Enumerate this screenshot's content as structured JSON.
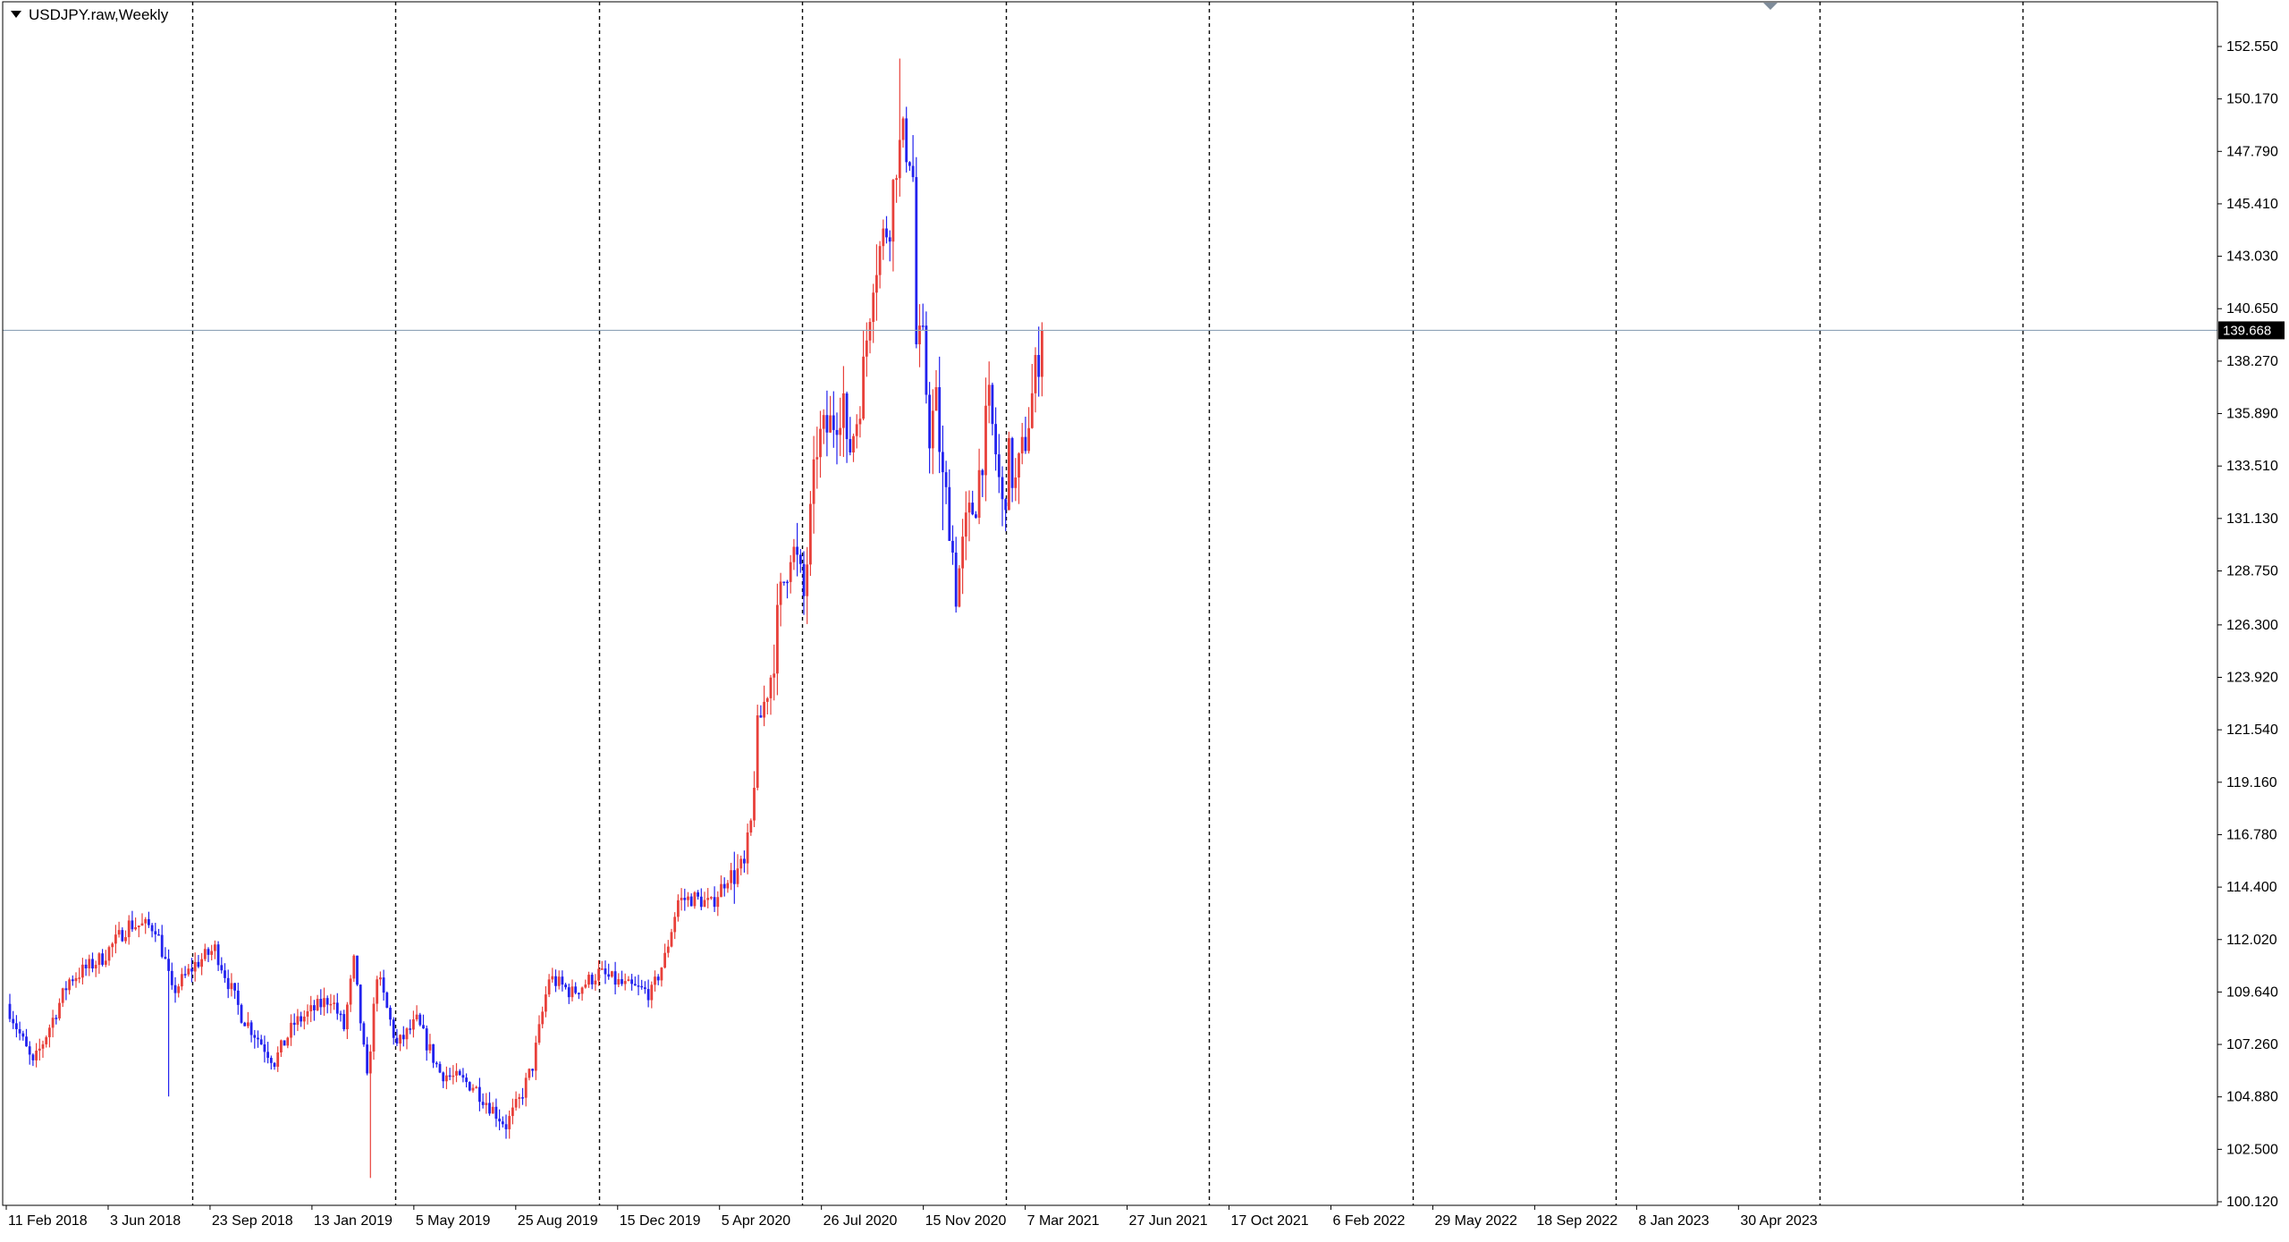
{
  "symbol_title": "USDJPY.raw,Weekly",
  "current_price_label": "139.668",
  "colors": {
    "bull": "#e8403a",
    "bear": "#2222ee",
    "grid": "#000000",
    "price_line": "#8fa3b8",
    "price_tag_bg": "#000000",
    "frame": "#000000"
  },
  "chart_data": {
    "type": "candlestick",
    "title": "USDJPY.raw,Weekly",
    "ylim": [
      100.12,
      153.5
    ],
    "current_price": 139.668,
    "y_ticks": [
      "152.550",
      "150.170",
      "147.790",
      "145.410",
      "143.030",
      "140.650",
      "138.270",
      "135.890",
      "133.510",
      "131.130",
      "128.750",
      "126.300",
      "123.920",
      "121.540",
      "119.160",
      "116.780",
      "114.400",
      "112.020",
      "109.640",
      "107.260",
      "104.880",
      "102.500",
      "100.120"
    ],
    "x_ticks": [
      "11 Feb 2018",
      "3 Jun 2018",
      "23 Sep 2018",
      "13 Jan 2019",
      "5 May 2019",
      "25 Aug 2019",
      "15 Dec 2019",
      "5 Apr 2020",
      "26 Jul 2020",
      "15 Nov 2020",
      "7 Mar 2021",
      "27 Jun 2021",
      "17 Oct 2021",
      "6 Feb 2022",
      "29 May 2022",
      "18 Sep 2022",
      "8 Jan 2023",
      "30 Apr 2023"
    ],
    "grid": "vertical-dashed",
    "key_points": [
      {
        "week": 0,
        "price": 108.8
      },
      {
        "week": 7,
        "price": 106.3
      },
      {
        "week": 18,
        "price": 110.2
      },
      {
        "week": 28,
        "price": 111.2
      },
      {
        "week": 36,
        "price": 112.7
      },
      {
        "week": 44,
        "price": 112.6
      },
      {
        "week": 47,
        "price": 111.0
      },
      {
        "week": 49,
        "price": 109.6
      },
      {
        "week": 56,
        "price": 110.9
      },
      {
        "week": 62,
        "price": 111.6
      },
      {
        "week": 70,
        "price": 108.6
      },
      {
        "week": 80,
        "price": 106.5
      },
      {
        "week": 86,
        "price": 108.2
      },
      {
        "week": 97,
        "price": 109.4
      },
      {
        "week": 101,
        "price": 108.0
      },
      {
        "week": 104,
        "price": 111.0
      },
      {
        "week": 108,
        "price": 105.6
      },
      {
        "week": 111,
        "price": 110.5
      },
      {
        "week": 117,
        "price": 107.2
      },
      {
        "week": 123,
        "price": 108.3
      },
      {
        "week": 130,
        "price": 106.0
      },
      {
        "week": 140,
        "price": 105.4
      },
      {
        "week": 145,
        "price": 104.5
      },
      {
        "week": 150,
        "price": 103.6
      },
      {
        "week": 154,
        "price": 104.7
      },
      {
        "week": 158,
        "price": 106.3
      },
      {
        "week": 163,
        "price": 110.3
      },
      {
        "week": 170,
        "price": 109.6
      },
      {
        "week": 178,
        "price": 110.5
      },
      {
        "week": 186,
        "price": 109.9
      },
      {
        "week": 194,
        "price": 109.6
      },
      {
        "week": 198,
        "price": 111.2
      },
      {
        "week": 202,
        "price": 113.8
      },
      {
        "week": 207,
        "price": 113.9
      },
      {
        "week": 212,
        "price": 113.6
      },
      {
        "week": 217,
        "price": 114.9
      },
      {
        "week": 222,
        "price": 115.2
      },
      {
        "week": 224,
        "price": 117.2
      },
      {
        "week": 226,
        "price": 121.5
      },
      {
        "week": 230,
        "price": 124.0
      },
      {
        "week": 233,
        "price": 127.5
      },
      {
        "week": 236,
        "price": 130.0
      },
      {
        "week": 238,
        "price": 129.0
      },
      {
        "week": 240,
        "price": 127.5
      },
      {
        "week": 244,
        "price": 134.5
      },
      {
        "week": 249,
        "price": 135.6
      },
      {
        "week": 252,
        "price": 136.7
      },
      {
        "week": 253,
        "price": 133.8
      },
      {
        "week": 256,
        "price": 135.7
      },
      {
        "week": 258,
        "price": 137.8
      },
      {
        "week": 261,
        "price": 142.4
      },
      {
        "week": 266,
        "price": 144.8
      },
      {
        "week": 268,
        "price": 147.5
      },
      {
        "week": 270,
        "price": 148.3
      },
      {
        "week": 272,
        "price": 147.8
      },
      {
        "week": 273,
        "price": 146.6
      },
      {
        "week": 274,
        "price": 139.0
      },
      {
        "week": 276,
        "price": 138.9
      },
      {
        "week": 278,
        "price": 135.1
      },
      {
        "week": 280,
        "price": 136.3
      },
      {
        "week": 282,
        "price": 132.7
      },
      {
        "week": 284,
        "price": 131.2
      },
      {
        "week": 286,
        "price": 127.9
      },
      {
        "week": 289,
        "price": 130.6
      },
      {
        "week": 292,
        "price": 132.1
      },
      {
        "week": 294,
        "price": 134.2
      },
      {
        "week": 296,
        "price": 136.2
      },
      {
        "week": 298,
        "price": 134.1
      },
      {
        "week": 300,
        "price": 131.5
      },
      {
        "week": 302,
        "price": 133.7
      },
      {
        "week": 304,
        "price": 132.6
      },
      {
        "week": 306,
        "price": 134.0
      },
      {
        "week": 308,
        "price": 135.7
      },
      {
        "week": 311,
        "price": 138.6
      },
      {
        "week": 312,
        "price": 139.668
      }
    ]
  }
}
